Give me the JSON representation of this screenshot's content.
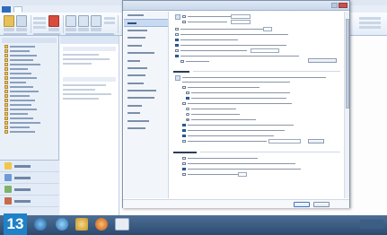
{
  "outlook": {
    "ribbon_tabs": [
      {
        "label": "",
        "kind": "file"
      },
      {
        "label": "",
        "kind": "active"
      },
      {
        "label": ""
      },
      {
        "label": ""
      },
      {
        "label": ""
      },
      {
        "label": ""
      }
    ],
    "list_header": "",
    "list_sections": [
      "",
      ""
    ],
    "nav_bottom_items": [
      "",
      "",
      "",
      ""
    ],
    "folder_count": 20
  },
  "dialog": {
    "title": "",
    "nav_items": [
      "",
      "",
      "",
      "",
      "",
      "",
      "",
      "",
      "",
      "",
      "",
      "",
      "",
      "",
      "",
      ""
    ],
    "nav_selected_index": 1,
    "sections": [
      {
        "heading": "",
        "options": 9
      },
      {
        "heading": "",
        "options": 13
      },
      {
        "heading": "",
        "options": 4
      }
    ],
    "ok_label": "",
    "cancel_label": ""
  },
  "step_badge": "13",
  "colors": {
    "accent": "#2e6bbd",
    "badge": "#1f82c9",
    "selection": "#c8daf2",
    "taskbar": "#3a5a80"
  }
}
